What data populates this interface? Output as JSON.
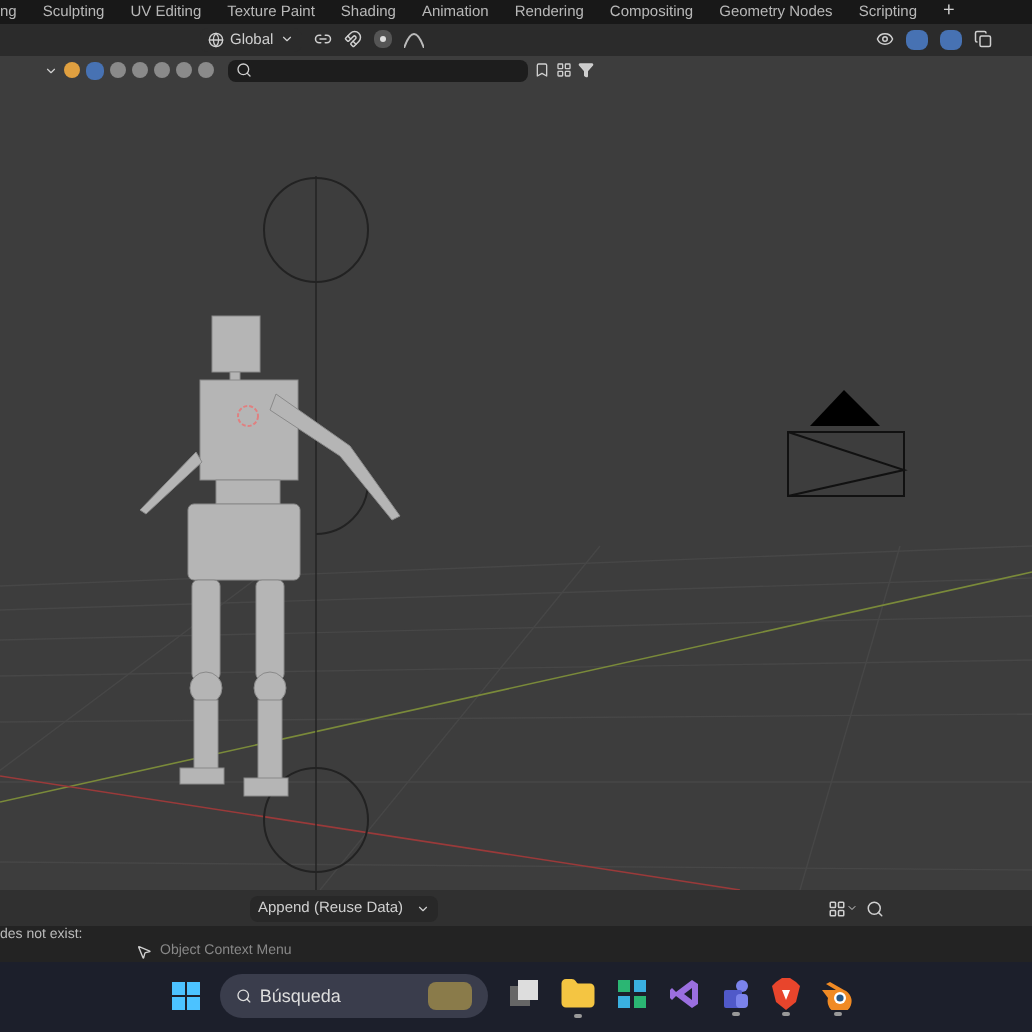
{
  "workspace_tabs": [
    {
      "label": "ng"
    },
    {
      "label": "Sculpting"
    },
    {
      "label": "UV Editing"
    },
    {
      "label": "Texture Paint"
    },
    {
      "label": "Shading"
    },
    {
      "label": "Animation"
    },
    {
      "label": "Rendering"
    },
    {
      "label": "Compositing"
    },
    {
      "label": "Geometry Nodes"
    },
    {
      "label": "Scripting"
    }
  ],
  "add_tab": "+",
  "header": {
    "orientation": "Global"
  },
  "file_browser": {
    "import_mode": "Append (Reuse Data)"
  },
  "status_bar": {
    "message": "des not exist:",
    "hint": "Object Context Menu"
  },
  "taskbar": {
    "search_placeholder": "Búsqueda",
    "apps": [
      {
        "kind": "files",
        "active": false
      },
      {
        "kind": "explorer",
        "active": true
      },
      {
        "kind": "tiles",
        "active": false
      },
      {
        "kind": "studio",
        "active": false
      },
      {
        "kind": "teams",
        "active": true
      },
      {
        "kind": "browser",
        "active": true
      },
      {
        "kind": "blender",
        "active": true
      }
    ]
  }
}
